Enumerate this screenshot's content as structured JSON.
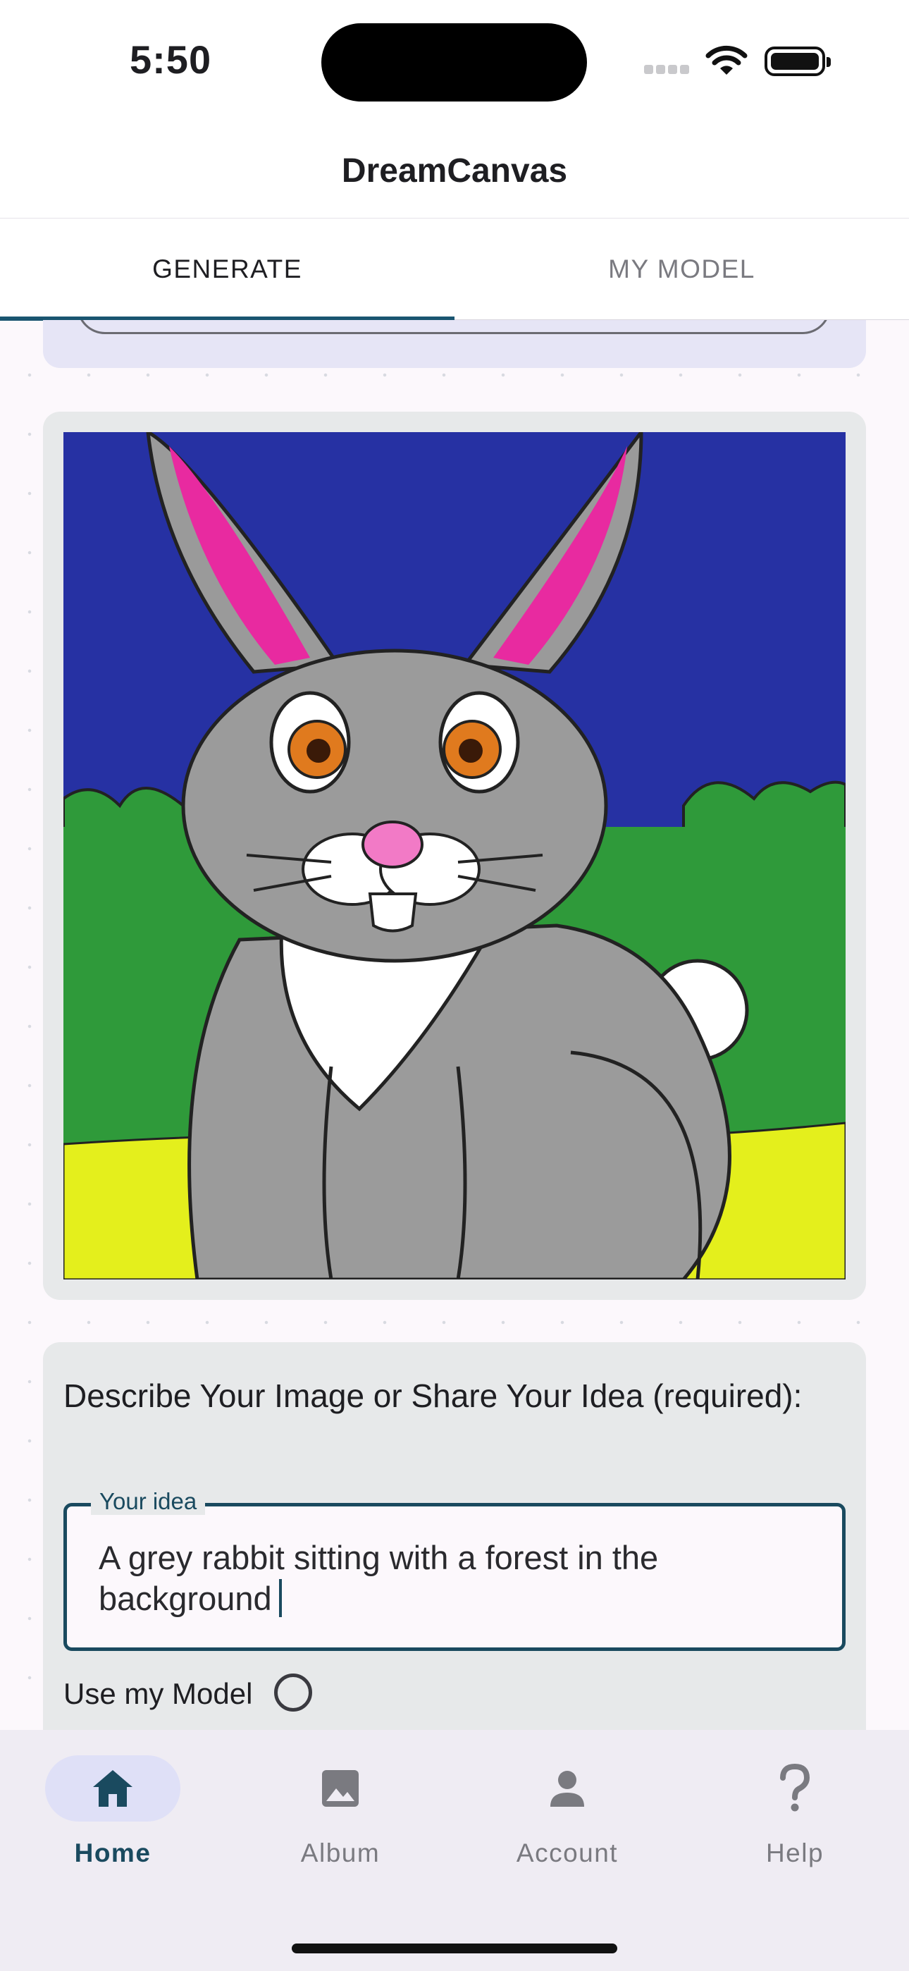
{
  "status_bar": {
    "time": "5:50"
  },
  "app": {
    "title": "DreamCanvas"
  },
  "tabs": [
    {
      "label": "GENERATE",
      "active": true
    },
    {
      "label": "MY MODEL",
      "active": false
    }
  ],
  "image_card": {
    "image": "grey-rabbit-drawing"
  },
  "prompt": {
    "heading": "Describe Your Image or Share Your Idea (required):",
    "field_label": "Your idea",
    "field_value": "A grey rabbit sitting with a forest in the background",
    "use_model_label": "Use my Model"
  },
  "bottom_nav": [
    {
      "label": "Home",
      "icon": "home-icon",
      "active": true
    },
    {
      "label": "Album",
      "icon": "image-icon",
      "active": false
    },
    {
      "label": "Account",
      "icon": "person-icon",
      "active": false
    },
    {
      "label": "Help",
      "icon": "help-icon",
      "active": false
    }
  ],
  "colors": {
    "accent": "#1a4a5f",
    "active_pill": "#dfe0f7",
    "card_bg": "#e7e9ea"
  }
}
